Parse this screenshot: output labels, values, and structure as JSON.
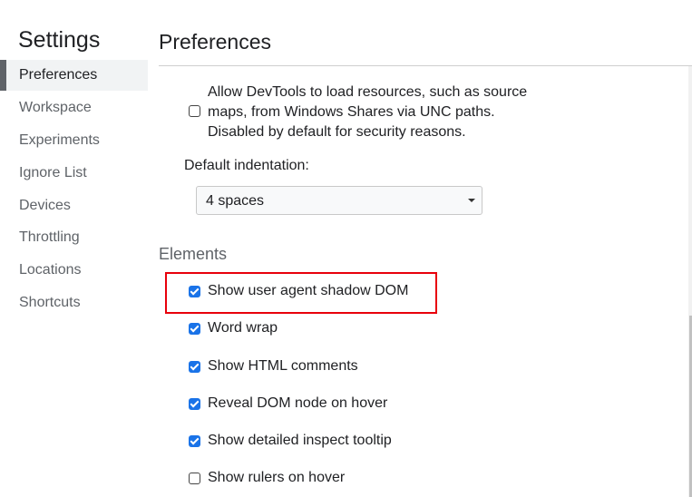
{
  "sidebar": {
    "title": "Settings",
    "items": [
      {
        "label": "Preferences",
        "selected": true
      },
      {
        "label": "Workspace"
      },
      {
        "label": "Experiments"
      },
      {
        "label": "Ignore List"
      },
      {
        "label": "Devices"
      },
      {
        "label": "Throttling"
      },
      {
        "label": "Locations"
      },
      {
        "label": "Shortcuts"
      }
    ]
  },
  "main": {
    "title": "Preferences",
    "unc_setting": {
      "label": "Allow DevTools to load resources, such as source maps, from Windows Shares via UNC paths. Disabled by default for security reasons.",
      "checked": false
    },
    "indentation": {
      "label": "Default indentation:",
      "value": "4 spaces"
    },
    "elements": {
      "header": "Elements",
      "options": [
        {
          "label": "Show user agent shadow DOM",
          "checked": true,
          "highlighted": true
        },
        {
          "label": "Word wrap",
          "checked": true
        },
        {
          "label": "Show HTML comments",
          "checked": true
        },
        {
          "label": "Reveal DOM node on hover",
          "checked": true
        },
        {
          "label": "Show detailed inspect tooltip",
          "checked": true
        },
        {
          "label": "Show rulers on hover",
          "checked": false
        }
      ]
    }
  },
  "colors": {
    "accent": "#1a73e8",
    "highlight": "#e8000b"
  }
}
